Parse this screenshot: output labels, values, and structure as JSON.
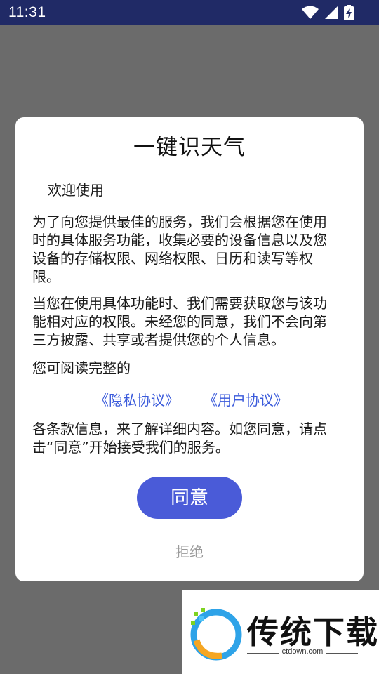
{
  "status_bar": {
    "time": "11:31",
    "icons": [
      "wifi-icon",
      "signal-icon",
      "battery-charging-icon"
    ]
  },
  "dialog": {
    "title": "一键识天气",
    "welcome": "欢迎使用",
    "para1_lines": [
      "为了向您提供最佳的服务，我们会根据您在使用",
      "时的具体服务功能，收集必要的设备信息以及您",
      "设备的存储权限、网络权限、日历和读写等权",
      "限。"
    ],
    "para2_lines": [
      "当您在使用具体功能时、我们需要获取您与该功",
      "能相对应的权限。未经您的同意，我们不会向第",
      "三方披露、共享或者提供您的个人信息。"
    ],
    "para3": "您可阅读完整的",
    "privacy_link": "《隐私协议》",
    "user_link": "《用户协议》",
    "para4_lines": [
      "各条款信息，来了解详细内容。如您同意，请点",
      "击“同意”开始接受我们的服务。"
    ],
    "agree_label": "同意",
    "reject_label": "拒绝"
  },
  "watermark": {
    "brand": "传统下载",
    "site": "ctdown.com"
  },
  "colors": {
    "status_bar": "#202a66",
    "overlay": "#6b6b6b",
    "primary_button": "#4a5bd8",
    "link": "#3b5bdb",
    "reject_text": "#9a9a9a"
  }
}
